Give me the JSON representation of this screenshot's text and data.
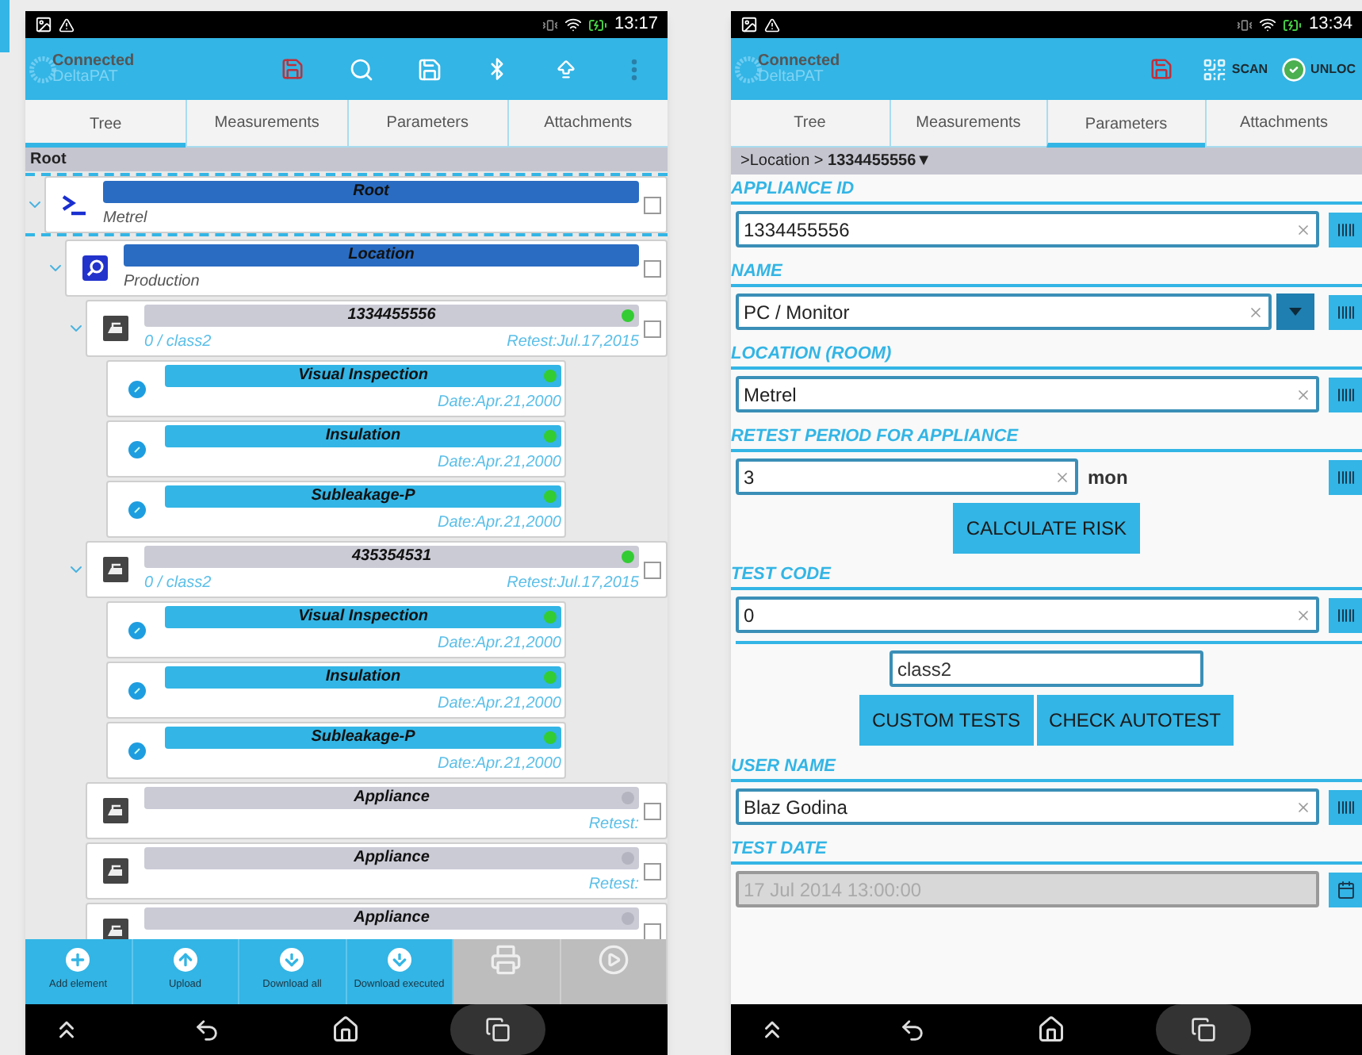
{
  "left_screen": {
    "status_bar": {
      "time": "13:17"
    },
    "app_bar": {
      "logo": [
        "Connected",
        "DeltaPAT"
      ],
      "actions": [
        {
          "kind": "export"
        },
        {
          "kind": "search"
        },
        {
          "kind": "save"
        },
        {
          "kind": "bluetooth"
        },
        {
          "kind": "upload"
        },
        {
          "kind": "overflow"
        }
      ]
    },
    "tabs": [
      {
        "label": "Tree",
        "selected": true
      },
      {
        "label": "Measurements",
        "selected": false
      },
      {
        "label": "Parameters",
        "selected": false
      },
      {
        "label": "Attachments",
        "selected": false
      }
    ],
    "breadcrumb": "Root",
    "tree": [
      {
        "kind": "root",
        "title": "Root",
        "subtitle": "Metrel",
        "expanded": true,
        "selected": true,
        "checked": false,
        "children": [
          {
            "kind": "location",
            "title": "Location",
            "subtitle": "Production",
            "expanded": true,
            "selected": false,
            "checked": false,
            "children": [
              {
                "kind": "appliance",
                "title": "1334455556",
                "subtitle": "0 / class2",
                "note": "Retest:Jul.17,2015",
                "color": "#33cc33",
                "expanded": true,
                "selected": false,
                "checked": false,
                "children": [
                  {
                    "kind": "test",
                    "title": "Visual Inspection",
                    "note": "Date:Apr.21,2000",
                    "color": "#33cc33",
                    "selected": false
                  },
                  {
                    "kind": "test",
                    "title": "Insulation",
                    "note": "Date:Apr.21,2000",
                    "color": "#33cc33",
                    "selected": false
                  },
                  {
                    "kind": "test",
                    "title": "Subleakage-P",
                    "note": "Date:Apr.21,2000",
                    "color": "#33cc33",
                    "selected": false
                  }
                ]
              },
              {
                "kind": "appliance",
                "title": "435354531",
                "subtitle": "0 / class2",
                "note": "Retest:Jul.17,2015",
                "color": "#33cc33",
                "expanded": true,
                "selected": false,
                "checked": false,
                "children": [
                  {
                    "kind": "test",
                    "title": "Visual Inspection",
                    "note": "Date:Apr.21,2000",
                    "color": "#33cc33",
                    "selected": false
                  },
                  {
                    "kind": "test",
                    "title": "Insulation",
                    "note": "Date:Apr.21,2000",
                    "color": "#33cc33",
                    "selected": false
                  },
                  {
                    "kind": "test",
                    "title": "Subleakage-P",
                    "note": "Date:Apr.21,2000",
                    "color": "#33cc33",
                    "selected": false
                  }
                ]
              },
              {
                "kind": "appliance",
                "title": "Appliance",
                "note": "Retest:",
                "color": "#b4b4c0",
                "selected": false,
                "checked": false
              },
              {
                "kind": "appliance",
                "title": "Appliance",
                "note": "Retest:",
                "color": "#b4b4c0",
                "selected": false,
                "checked": false
              },
              {
                "kind": "appliance",
                "title": "Appliance",
                "color": "#b4b4c0",
                "selected": false,
                "checked": false
              }
            ]
          }
        ]
      }
    ],
    "toolbar": [
      {
        "kind": "add",
        "label": "Add element",
        "disabled": false
      },
      {
        "kind": "upload",
        "label": "Upload",
        "disabled": false
      },
      {
        "kind": "download",
        "label": "Download all",
        "disabled": false
      },
      {
        "kind": "executed",
        "label": "Download executed",
        "disabled": false
      },
      {
        "kind": "print",
        "disabled": true
      },
      {
        "kind": "play",
        "disabled": true
      }
    ]
  },
  "right_screen": {
    "status_bar": {
      "time": "13:34"
    },
    "app_bar": {
      "logo": [
        "Connected",
        "DeltaPAT"
      ],
      "actions": [
        {
          "kind": "export"
        },
        {
          "kind": "scan",
          "label": "SCAN"
        },
        {
          "kind": "unlock",
          "label": "UNLOC"
        }
      ]
    },
    "tabs": [
      {
        "label": "Tree",
        "selected": false
      },
      {
        "label": "Measurements",
        "selected": false
      },
      {
        "label": "Parameters",
        "selected": true
      },
      {
        "label": "Attachments",
        "selected": false
      }
    ],
    "breadcrumb": ">Location > **1334455556▼**",
    "fields": [
      {
        "kind": "text",
        "label": "APPLIANCE ID",
        "value": "1334455556",
        "disabled": false
      },
      {
        "kind": "select",
        "label": "NAME",
        "value": "PC / Monitor",
        "disabled": false
      },
      {
        "kind": "text",
        "label": "LOCATION (ROOM)",
        "value": "Metrel",
        "disabled": false
      },
      {
        "kind": "period",
        "label": "RETEST PERIOD FOR APPLIANCE",
        "value": "3",
        "unit": "mon",
        "disabled": false,
        "buttons": [
          "CALCULATE RISK"
        ]
      },
      {
        "kind": "code",
        "label": "TEST CODE",
        "value": "0",
        "class_value": "class2",
        "disabled": false,
        "buttons": [
          "CUSTOM TESTS",
          "CHECK AUTOTEST"
        ]
      },
      {
        "kind": "text",
        "label": "USER NAME",
        "value": "Blaz Godina",
        "disabled": false
      },
      {
        "kind": "date",
        "label": "TEST DATE",
        "value": "17 Jul 2014 13:00:00",
        "disabled": true
      }
    ]
  }
}
